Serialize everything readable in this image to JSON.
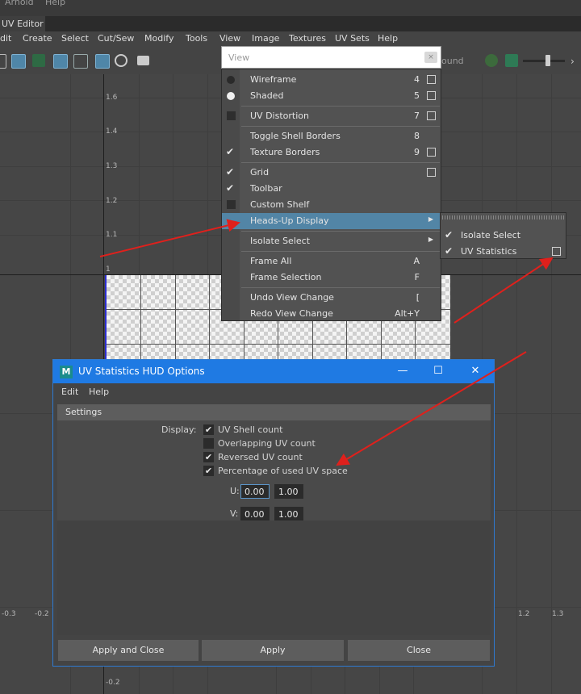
{
  "topstrip": {
    "items": [
      "Arnold",
      "Help"
    ]
  },
  "window": {
    "title": "UV Editor"
  },
  "menubar": [
    "dit",
    "Create",
    "Select",
    "Cut/Sew",
    "Modify",
    "Tools",
    "View",
    "Image",
    "Textures",
    "UV Sets",
    "Help"
  ],
  "toolbar": {
    "partial_text": "ound"
  },
  "viewport": {
    "y_labels": [
      "1.6",
      "1.4",
      "1.3",
      "1.2",
      "1.1",
      "1"
    ],
    "x_labels": [
      "-0.3",
      "-0.2",
      "1.2",
      "1.3"
    ],
    "bottom_label": "-0.2"
  },
  "view_menu": {
    "search_placeholder": "View",
    "clear_icon": "×",
    "items": [
      {
        "label": "Wireframe",
        "shortcut": "4",
        "mark": "dot-dark",
        "box": true
      },
      {
        "label": "Shaded",
        "shortcut": "5",
        "mark": "dot-light",
        "box": true
      },
      {
        "label": "UV Distortion",
        "shortcut": "7",
        "mark": "square",
        "box": true
      },
      {
        "label": "Toggle Shell Borders",
        "shortcut": "8",
        "mark": "none",
        "box": false
      },
      {
        "label": "Texture Borders",
        "shortcut": "9",
        "mark": "check",
        "box": true
      },
      {
        "label": "Grid",
        "shortcut": "",
        "mark": "check",
        "box": true
      },
      {
        "label": "Toolbar",
        "shortcut": "",
        "mark": "check",
        "box": false
      },
      {
        "label": "Custom Shelf",
        "shortcut": "",
        "mark": "square",
        "box": false
      },
      {
        "label": "Heads-Up Display",
        "shortcut": "",
        "mark": "none",
        "submenu": true
      },
      {
        "label": "Isolate Select",
        "shortcut": "",
        "mark": "none",
        "submenu": true
      },
      {
        "label": "Frame All",
        "shortcut": "A",
        "mark": "none"
      },
      {
        "label": "Frame Selection",
        "shortcut": "F",
        "mark": "none"
      },
      {
        "label": "Undo View Change",
        "shortcut": "[",
        "mark": "none"
      },
      {
        "label": "Redo View Change",
        "shortcut": "Alt+Y",
        "mark": "none"
      }
    ]
  },
  "hud_submenu": {
    "items": [
      {
        "label": "Isolate Select",
        "checked": true,
        "box": false
      },
      {
        "label": "UV Statistics",
        "checked": true,
        "box": true
      }
    ]
  },
  "dialog": {
    "title": "UV Statistics HUD Options",
    "app_icon": "M",
    "window_buttons": [
      "—",
      "☐",
      "✕"
    ],
    "menu": [
      "Edit",
      "Help"
    ],
    "section": "Settings",
    "display_label": "Display:",
    "options": [
      {
        "label": "UV Shell count",
        "checked": true
      },
      {
        "label": "Overlapping UV count",
        "checked": false
      },
      {
        "label": "Reversed UV count",
        "checked": true
      },
      {
        "label": "Percentage of used UV space",
        "checked": true
      }
    ],
    "u_label": "U:",
    "u_min": "0.00",
    "u_max": "1.00",
    "v_label": "V:",
    "v_min": "0.00",
    "v_max": "1.00",
    "buttons": [
      "Apply and Close",
      "Apply",
      "Close"
    ]
  },
  "colors": {
    "highlight": "#5285a6",
    "dialog_title": "#1f7ae3",
    "annotation_arrow": "#e0201c"
  }
}
